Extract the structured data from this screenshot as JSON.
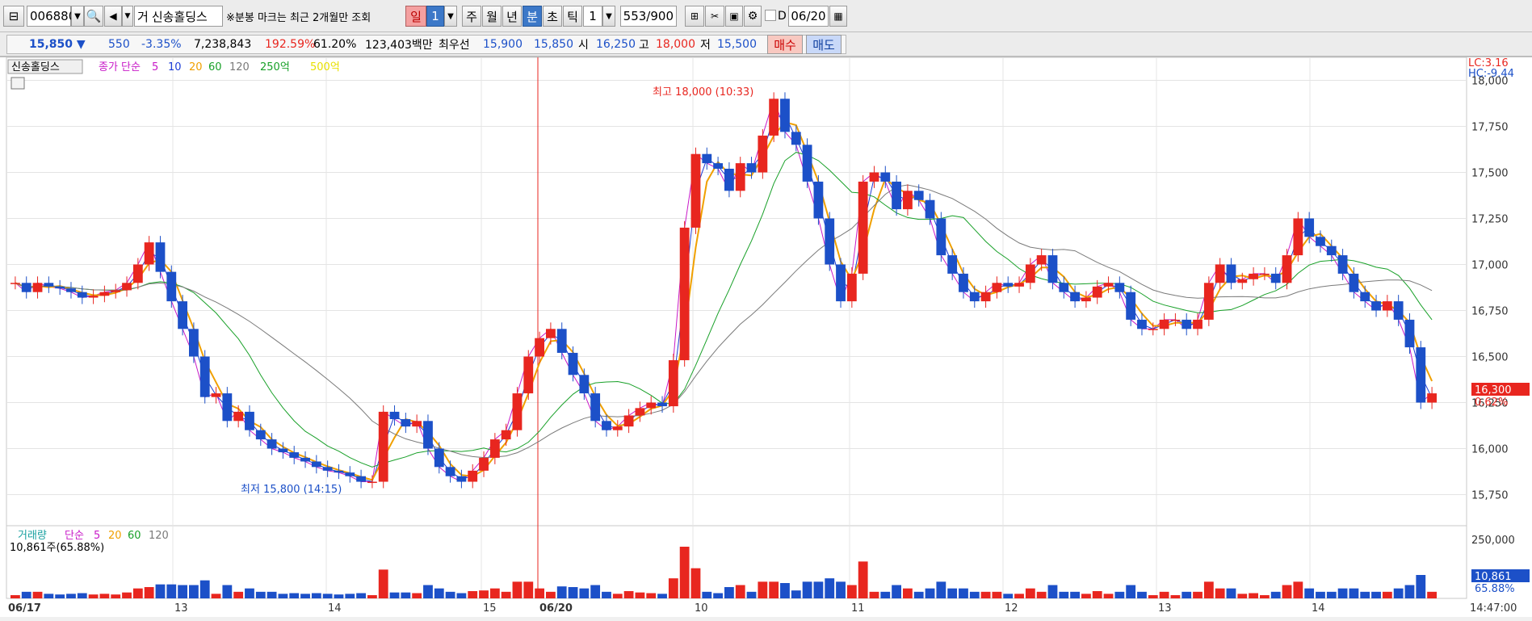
{
  "toolbar": {
    "code": "006880",
    "market_mark": "거",
    "name": "신송홀딩스",
    "notice": "※분봉 마크는 최근 2개월만 조회",
    "period_day": "일",
    "period_day_count": "1",
    "period_week": "주",
    "period_month": "월",
    "period_year": "년",
    "period_minute": "분",
    "period_second": "초",
    "period_tick": "틱",
    "interval": "1",
    "count": "553/900",
    "checkbox_label": "D",
    "date": "06/20"
  },
  "quote": {
    "price": "15,850 ▼",
    "change": "550",
    "change_pct": "-3.35%",
    "volume": "7,238,843",
    "volume_ratio": "192.59%",
    "turnover": "61.20%",
    "amount": "123,403백만",
    "best_label": "최우선",
    "best_ask": "15,900",
    "best_bid": "15,850",
    "open_label": "시",
    "open": "16,250",
    "high_label": "고",
    "high": "18,000",
    "low_label": "저",
    "low": "15,500",
    "buy_label": "매수",
    "sell_label": "매도"
  },
  "colors": {
    "up": "#e8261f",
    "down": "#1c50c8",
    "ma5": "#c819c8",
    "ma10": "#1c3cd6",
    "ma20": "#f0a000",
    "ma60": "#18a028",
    "ma120": "#7a7a7a"
  },
  "price_legend": {
    "name": "신송홀딩스",
    "close_simple": "종가 단순",
    "p5": "5",
    "p10": "10",
    "p20": "20",
    "p60": "60",
    "p120": "120",
    "v250": "250억",
    "v500": "500억"
  },
  "volume_legend": {
    "title": "거래량",
    "simple": "단순",
    "p5": "5",
    "p20": "20",
    "p60": "60",
    "p120": "120",
    "current": "10,861주(65.88%)"
  },
  "right_info": {
    "lc": "LC:3.16",
    "hc": "HC:-9.44",
    "last_price": "16,300",
    "last_pct": "0.62%",
    "vol_max": "250,000",
    "vol_last": "10,861",
    "vol_pct": "65.88%"
  },
  "annotations": {
    "high": "최고 18,000 (10:33)",
    "low": "최저 15,800 (14:15)"
  },
  "chart_data": {
    "type": "candlestick",
    "y_ticks": [
      "18,000",
      "17,750",
      "17,500",
      "17,250",
      "17,000",
      "16,750",
      "16,500",
      "16,250",
      "16,000",
      "15,750"
    ],
    "ylim": [
      15625,
      18125
    ],
    "x_labels": [
      "06/17",
      "13",
      "14",
      "15",
      "06/20",
      "10",
      "11",
      "12",
      "13",
      "14"
    ],
    "end_time": "14:47:00",
    "close_series": [
      16900,
      16850,
      16900,
      16880,
      16870,
      16850,
      16820,
      16830,
      16850,
      16860,
      16900,
      17000,
      17120,
      16960,
      16800,
      16650,
      16500,
      16280,
      16300,
      16150,
      16200,
      16100,
      16050,
      16000,
      15980,
      15950,
      15930,
      15900,
      15880,
      15870,
      15850,
      15820,
      15820,
      16200,
      16160,
      16120,
      16150,
      16000,
      15900,
      15850,
      15820,
      15880,
      15950,
      16050,
      16100,
      16300,
      16500,
      16600,
      16650,
      16520,
      16400,
      16300,
      16150,
      16100,
      16120,
      16180,
      16220,
      16250,
      16230,
      16480,
      17200,
      17600,
      17550,
      17520,
      17400,
      17550,
      17500,
      17700,
      17900,
      17720,
      17650,
      17450,
      17250,
      17000,
      16800,
      16950,
      17450,
      17500,
      17450,
      17300,
      17400,
      17350,
      17250,
      17050,
      16950,
      16850,
      16800,
      16850,
      16900,
      16880,
      16900,
      17000,
      17050,
      16900,
      16850,
      16800,
      16820,
      16880,
      16900,
      16850,
      16700,
      16650,
      16650,
      16700,
      16700,
      16650,
      16700,
      16900,
      17000,
      16900,
      16920,
      16950,
      16950,
      16900,
      17050,
      17250,
      17150,
      17100,
      17050,
      16950,
      16850,
      16800,
      16750,
      16800,
      16700,
      16550,
      16250,
      16300
    ]
  }
}
